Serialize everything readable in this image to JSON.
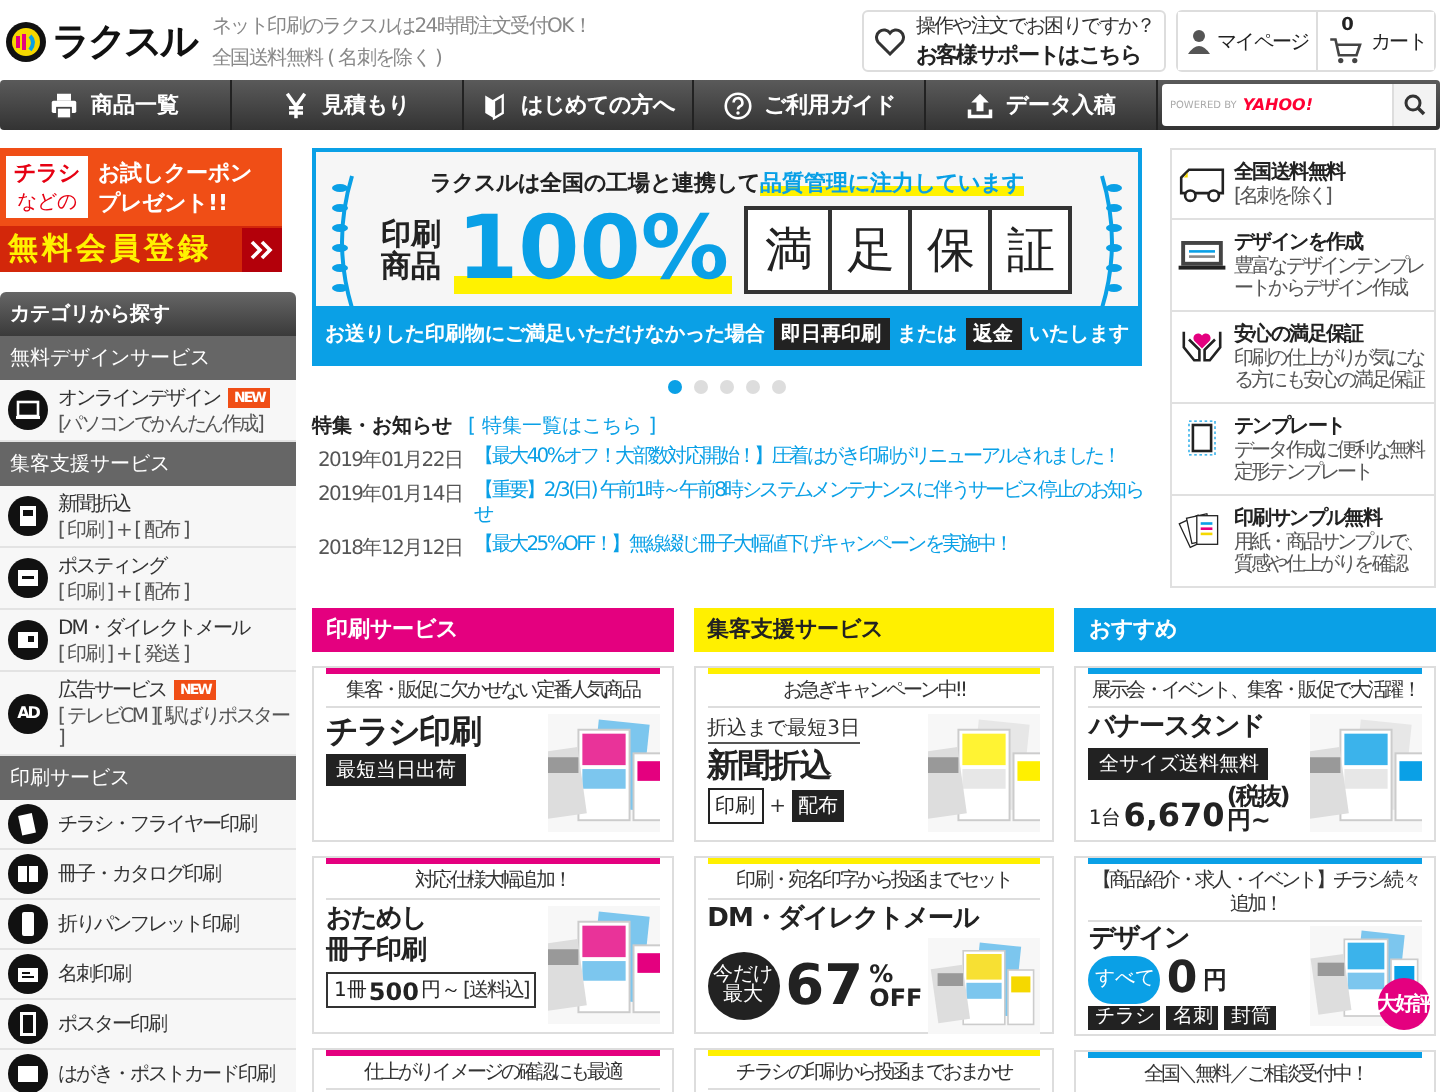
{
  "header": {
    "logo": "ラクスル",
    "tagline": [
      "ネット印刷のラクスルは24時間注文受付OK！",
      "全国送料無料 ( 名刺を除く )"
    ],
    "support": {
      "note": "操作や注文でお困りですか？",
      "label": "お客様サポートはこちら"
    },
    "mypage": "マイページ",
    "cart": {
      "count": "0",
      "label": "カート"
    }
  },
  "nav": {
    "items": [
      {
        "label": "商品一覧"
      },
      {
        "label": "見積もり"
      },
      {
        "label": "はじめての方へ"
      },
      {
        "label": "ご利用ガイド"
      },
      {
        "label": "データ入稿"
      }
    ],
    "search": {
      "powered": "POWERED BY",
      "brand": "YAHOO!"
    }
  },
  "coupon": {
    "tag": [
      "チラシ",
      "などの"
    ],
    "headline": [
      "お試しクーポン",
      "プレゼント!!"
    ],
    "cta": "無料会員登録"
  },
  "categories": {
    "title": "カテゴリから探す",
    "sections": [
      {
        "title": "無料デザインサービス",
        "items": [
          {
            "label": "オンラインデザイン",
            "badge": "NEW",
            "sub": "[パソコンでかんたん作成]"
          }
        ]
      },
      {
        "title": "集客支援サービス",
        "items": [
          {
            "label": "新聞折込",
            "sub": "[ 印刷 ] + [ 配布 ]"
          },
          {
            "label": "ポスティング",
            "sub": "[ 印刷 ] + [ 配布 ]"
          },
          {
            "label": "DM・ダイレクトメール",
            "sub": "[ 印刷 ] + [ 発送 ]"
          },
          {
            "icon_label": "AD",
            "label": "広告サービス",
            "badge": "NEW",
            "sub": "[ テレビCM ][ 駅ばりポスター ]"
          }
        ]
      },
      {
        "title": "印刷サービス",
        "items": [
          {
            "label": "チラシ・フライヤー印刷"
          },
          {
            "label": "冊子・カタログ印刷"
          },
          {
            "label": "折りパンフレット印刷"
          },
          {
            "label": "名刺印刷"
          },
          {
            "label": "ポスター印刷"
          },
          {
            "label": "はがき・ポストカード印刷"
          }
        ]
      }
    ]
  },
  "banner": {
    "lead": "ラクスルは全国の工場と連携して",
    "lead_highlight": "品質管理に注力しています",
    "left": [
      "印刷",
      "商品"
    ],
    "big": "100%",
    "boxes": [
      "満",
      "足",
      "保",
      "証"
    ],
    "bottom": [
      {
        "kind": "text",
        "text": "お送りした印刷物にご満足いただけなかった場合"
      },
      {
        "kind": "tag",
        "text": "即日再印刷"
      },
      {
        "kind": "text",
        "text": "または"
      },
      {
        "kind": "tag",
        "text": "返金"
      },
      {
        "kind": "text",
        "text": "いたします"
      }
    ]
  },
  "slides": [
    {
      "selected": true
    },
    {
      "selected": false
    },
    {
      "selected": false
    },
    {
      "selected": false
    },
    {
      "selected": false
    }
  ],
  "news": {
    "title": "特集・お知らせ",
    "link": "[ 特集一覧はこちら ]",
    "items": [
      {
        "date": "2019年01月22日",
        "text": "【最大40%オフ！大部数対応開始！】圧着はがき印刷がリニューアルされました！"
      },
      {
        "date": "2019年01月14日",
        "text": "【重要】2/3(日) 午前1時～午前8時システムメンテナンスに伴うサービス停止のお知らせ"
      },
      {
        "date": "2018年12月12日",
        "text": "【最大25%OFF！】無線綴じ冊子大幅値下げキャンペーンを実施中！"
      }
    ]
  },
  "features": [
    {
      "title": "全国送料無料",
      "desc": "[名刺を除く]"
    },
    {
      "title": "デザインを作成",
      "desc": "豊富なデザインテンプレートからデザイン作成"
    },
    {
      "title": "安心の満足保証",
      "desc": "印刷の仕上がりが気になる方にも安心の満足保証"
    },
    {
      "title": "テンプレート",
      "desc": "データ作成に便利な無料定形テンプレート"
    },
    {
      "title": "印刷サンプル無料",
      "desc": "用紙・商品サンプルで、質感や仕上がりを確認"
    }
  ],
  "services": [
    {
      "title": "印刷サービス",
      "color": "#e4007f",
      "cards": [
        {
          "kind": "flyer",
          "headline": "集客・販促に欠かせない定番人気商品",
          "title": "チラシ印刷",
          "tag": "最短当日出荷"
        },
        {
          "kind": "booklet",
          "headline": "対応仕様大幅追加！",
          "title_lines": [
            "おためし",
            "冊子印刷"
          ],
          "price": {
            "prefix": "1冊",
            "amount": "500",
            "unit": "円～",
            "note": "[送料込]"
          }
        },
        {
          "kind": "teaser",
          "headline": "仕上がりイメージの確認にも最適"
        }
      ]
    },
    {
      "title": "集客支援サービス",
      "color": "#fff000",
      "cards": [
        {
          "kind": "insert",
          "headline": "お急ぎキャンペーン中!!",
          "sub": "折込まで最短3日",
          "title": "新聞折込",
          "chips": [
            "印刷",
            "+",
            "配布"
          ]
        },
        {
          "kind": "dm",
          "headline": "印刷・宛名印字から投函までセット",
          "title": "DM・ダイレクトメール",
          "circle": [
            "今だけ",
            "最大"
          ],
          "amount": "67",
          "unit": [
            "%",
            "OFF"
          ]
        },
        {
          "kind": "teaser",
          "headline": "チラシの印刷から投函までおまかせ"
        }
      ]
    },
    {
      "title": "おすすめ",
      "color": "#0aa0e6",
      "cards": [
        {
          "kind": "stand",
          "headline": "展示会・イベント、集客・販促で大活躍！",
          "title": "バナースタンド",
          "tag": "全サイズ送料無料",
          "price": {
            "prefix": "1台",
            "amount": "6,670",
            "note": "(税抜)",
            "unit": "円~"
          }
        },
        {
          "kind": "design",
          "headline": "【商品紹介・求人・イベント】チラシ続々追加！",
          "title": "デザイン",
          "circle": [
            "すべて"
          ],
          "amount": "0",
          "unit": [
            "円"
          ],
          "chips": [
            "チラシ",
            "名刺",
            "封筒"
          ],
          "badge": "大好評"
        },
        {
          "kind": "teaser",
          "headline": "全国＼無料／ご相談受付中！"
        }
      ]
    }
  ]
}
